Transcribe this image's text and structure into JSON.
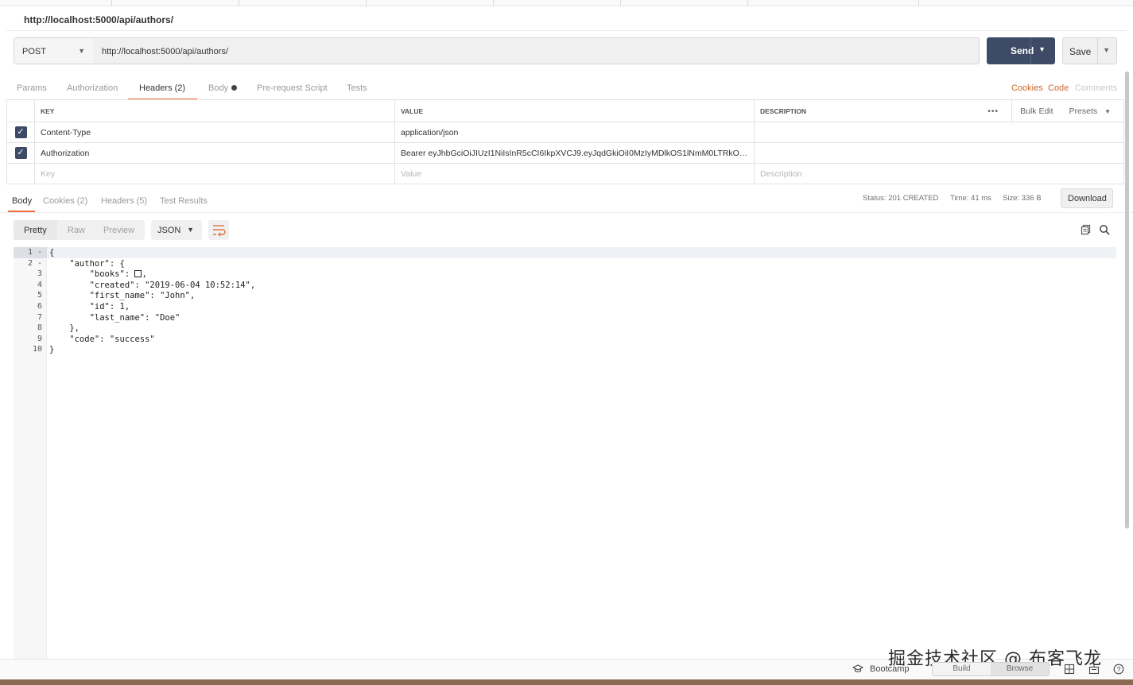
{
  "request": {
    "title": "http://localhost:5000/api/authors/",
    "method": "POST",
    "url": "http://localhost:5000/api/authors/",
    "send_label": "Send",
    "save_label": "Save"
  },
  "request_tabs": [
    "Params",
    "Authorization",
    "Headers (2)",
    "Body",
    "Pre-request Script",
    "Tests"
  ],
  "request_links": {
    "cookies": "Cookies",
    "code": "Code",
    "comments": "Comments"
  },
  "headers_table": {
    "columns": [
      "KEY",
      "VALUE",
      "DESCRIPTION"
    ],
    "actions": {
      "more": "•••",
      "bulk_edit": "Bulk Edit",
      "presets": "Presets"
    },
    "rows": [
      {
        "checked": true,
        "key": "Content-Type",
        "value": "application/json",
        "description": ""
      },
      {
        "checked": true,
        "key": "Authorization",
        "value": "Bearer eyJhbGciOiJIUzI1NiIsInR5cCI6IkpXVCJ9.eyJqdGkiOiI0MzIyMDlkOS1lNmM0LTRkOG…",
        "description": ""
      }
    ],
    "placeholders": {
      "key": "Key",
      "value": "Value",
      "description": "Description"
    }
  },
  "response_tabs": [
    "Body",
    "Cookies (2)",
    "Headers (5)",
    "Test Results"
  ],
  "response_meta": {
    "status": "Status: 201 CREATED",
    "time": "Time: 41 ms",
    "size": "Size: 336 B",
    "download": "Download"
  },
  "format": {
    "modes": [
      "Pretty",
      "Raw",
      "Preview"
    ],
    "active_mode": "Pretty",
    "language": "JSON"
  },
  "code_lines": [
    {
      "num": "1 -",
      "text": "{"
    },
    {
      "num": "2 -",
      "text": "    \"author\": {"
    },
    {
      "num": "3",
      "text": "        \"books\": "
    },
    {
      "num": "4",
      "text": "        \"created\": \"2019-06-04 10:52:14\","
    },
    {
      "num": "5",
      "text": "        \"first_name\": \"John\","
    },
    {
      "num": "6",
      "text": "        \"id\": 1,"
    },
    {
      "num": "7",
      "text": "        \"last_name\": \"Doe\""
    },
    {
      "num": "8",
      "text": "    },"
    },
    {
      "num": "9",
      "text": "    \"code\": \"success\""
    },
    {
      "num": "10",
      "text": "}"
    }
  ],
  "code_line3_suffix": ",",
  "status_bar": {
    "bootcamp": "Bootcamp",
    "build": "Build",
    "browse": "Browse",
    "active_toggle": "Browse"
  },
  "watermark": "掘金技术社区 @ 布客飞龙",
  "colors": {
    "accent": "#f26b3a",
    "send_button": "#3d4b66",
    "link_orange": "#d0672c"
  }
}
